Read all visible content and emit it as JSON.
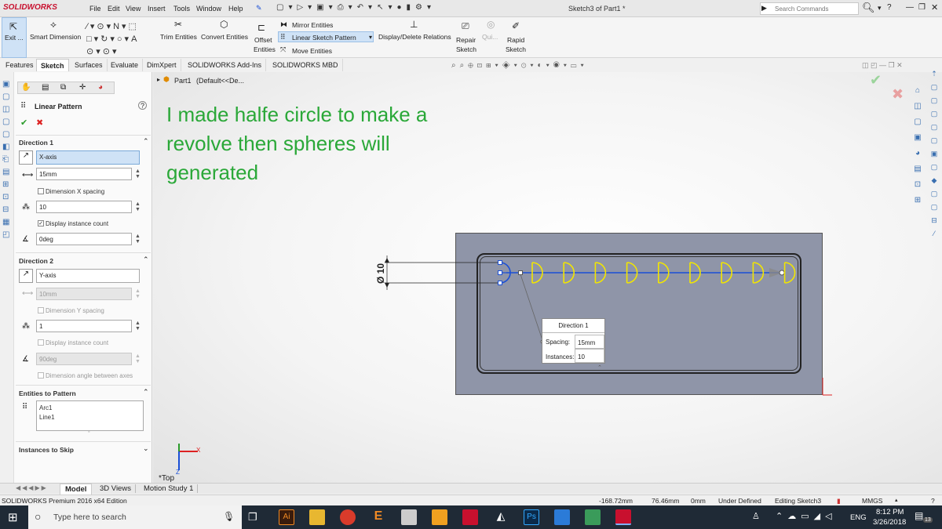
{
  "app": {
    "logo": "SOLIDWORKS",
    "menu": [
      "File",
      "Edit",
      "View",
      "Insert",
      "Tools",
      "Window",
      "Help"
    ],
    "doc_title": "Sketch3 of Part1 *",
    "search_placeholder": "Search Commands"
  },
  "commands": {
    "exit": "Exit ...",
    "smart_dimension": "Smart Dimension",
    "trim": "Trim Entities",
    "convert": "Convert Entities",
    "offset_1": "Offset",
    "offset_2": "Entities",
    "mirror": "Mirror Entities",
    "linear_pattern": "Linear Sketch Pattern",
    "move": "Move Entities",
    "display_delete": "Display/Delete Relations",
    "repair_1": "Repair",
    "repair_2": "Sketch",
    "quick": "Qui...",
    "rapid_1": "Rapid",
    "rapid_2": "Sketch"
  },
  "tabs": [
    "Features",
    "Sketch",
    "Surfaces",
    "Evaluate",
    "DimXpert",
    "SOLIDWORKS Add-Ins",
    "SOLIDWORKS MBD"
  ],
  "active_tab": "Sketch",
  "property_manager": {
    "title": "Linear Pattern",
    "direction1": {
      "title": "Direction 1",
      "axis": "X-axis",
      "spacing": "15mm",
      "dimension_spacing_label": "Dimension X spacing",
      "instances": "10",
      "display_count_label": "Display instance count",
      "angle": "0deg"
    },
    "direction2": {
      "title": "Direction 2",
      "axis": "Y-axis",
      "spacing": "10mm",
      "dimension_spacing_label": "Dimension Y spacing",
      "instances": "1",
      "display_count_label": "Display instance count",
      "angle": "90deg",
      "angle_label": "Dimension angle between axes"
    },
    "entities": {
      "title": "Entities to Pattern",
      "items": [
        "Arc1",
        "Line1"
      ]
    },
    "skip_title": "Instances to Skip"
  },
  "tree": {
    "part": "Part1",
    "config": "(Default<<De..."
  },
  "annotation": "I made halfe circle to make a revolve then spheres will generated",
  "callout": {
    "title": "Direction 1",
    "spacing_label": "Spacing:",
    "spacing_value": "15mm",
    "instances_label": "Instances:",
    "instances_value": "10"
  },
  "dimension_label": "Ø 10",
  "triad_x": "X",
  "triad_z": "Z",
  "view_label": "*Top",
  "bottom_tabs": [
    "Model",
    "3D Views",
    "Motion Study 1"
  ],
  "status": {
    "edition": "SOLIDWORKS Premium 2016 x64 Edition",
    "x": "-168.72mm",
    "y": "76.46mm",
    "z": "0mm",
    "defined": "Under Defined",
    "editing": "Editing Sketch3",
    "units": "MMGS"
  },
  "taskbar": {
    "search_placeholder": "Type here to search",
    "lang": "ENG",
    "time": "8:12 PM",
    "date": "3/26/2018",
    "notif_count": "13"
  },
  "colors": {
    "accent_blue": "#1a4fd6",
    "arc_yellow": "#f2e600",
    "annotation_green": "#2aa838",
    "plate": "#8f95a8"
  }
}
